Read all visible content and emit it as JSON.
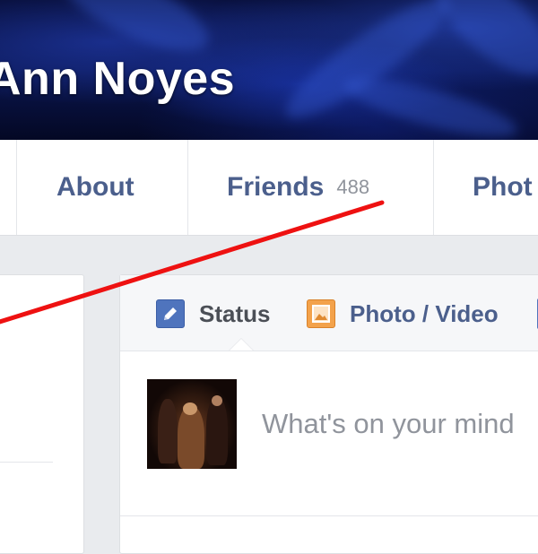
{
  "profile": {
    "name": "Ann Noyes"
  },
  "tabs": {
    "about": "About",
    "friends": "Friends",
    "friends_count": "488",
    "photos": "Phot"
  },
  "composer": {
    "status_label": "Status",
    "photo_label": "Photo / Video",
    "placeholder": "What's on your mind"
  },
  "colors": {
    "tab_text": "#4b5f8c",
    "annotation_line": "#ee1111",
    "status_icon": "#4f74bd",
    "photo_icon": "#f3a24b"
  },
  "icons": {
    "status": "pencil-icon",
    "photo": "photo-icon"
  }
}
